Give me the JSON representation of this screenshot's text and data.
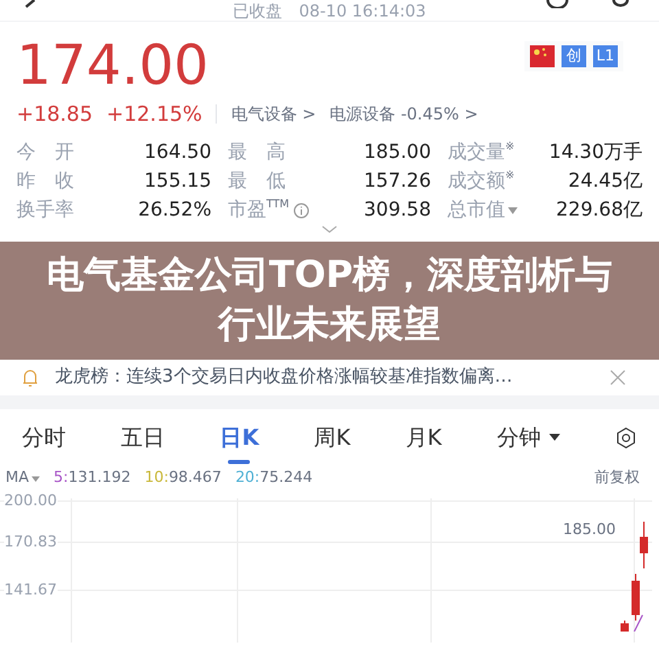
{
  "header": {
    "status": "已收盘",
    "time": "08-10 16:14:03"
  },
  "quote": {
    "price": "174.00",
    "change": "+18.85",
    "change_pct": "+12.15%",
    "sector": "电气设备 >",
    "sub_sector": "电源设备 -0.45% >",
    "badges": [
      {
        "kind": "flag"
      },
      {
        "kind": "text",
        "label": "创"
      },
      {
        "kind": "text",
        "label": "L1"
      }
    ]
  },
  "stats": [
    {
      "label": "今　开",
      "value": "164.50"
    },
    {
      "label": "最　高",
      "value": "185.00"
    },
    {
      "label": "成交量",
      "value": "14.30万手",
      "kind": "note",
      "mark": "※"
    },
    {
      "label": "昨　收",
      "value": "155.15"
    },
    {
      "label": "最　低",
      "value": "157.26"
    },
    {
      "label": "成交额",
      "value": "24.45亿",
      "kind": "note",
      "mark": "※"
    },
    {
      "label": "换手率",
      "value": "26.52%"
    },
    {
      "label": "市盈",
      "value": "309.58",
      "kind": "info",
      "suffix": "TTM"
    },
    {
      "label": "总市值",
      "value": "229.68亿",
      "kind": "dropdown"
    }
  ],
  "banner": {
    "title": "电气基金公司TOP榜，深度剖析与行业未来展望"
  },
  "notices": [
    {
      "kind": "bell",
      "text": "龙虎榜：连续3个交易日内收盘价格涨幅较基准指数偏离…"
    }
  ],
  "chart_tabs": [
    {
      "label": "分时",
      "selected": false
    },
    {
      "label": "五日",
      "selected": false
    },
    {
      "label": "日K",
      "selected": true
    },
    {
      "label": "周K",
      "selected": false
    },
    {
      "label": "月K",
      "selected": false
    },
    {
      "label": "分钟",
      "selected": false,
      "dropdown": true
    }
  ],
  "ma": {
    "label": "MA",
    "lines": [
      {
        "period": "5:",
        "value": "131.192",
        "color": "#a855c7"
      },
      {
        "period": "10:",
        "value": "98.467",
        "color": "#c9b83a"
      },
      {
        "period": "20:",
        "value": "75.244",
        "color": "#4fb0d4"
      }
    ],
    "adjust": "前复权"
  },
  "y_labels": [
    "200.00",
    "170.83",
    "141.67"
  ],
  "high_marker": "185.00"
}
